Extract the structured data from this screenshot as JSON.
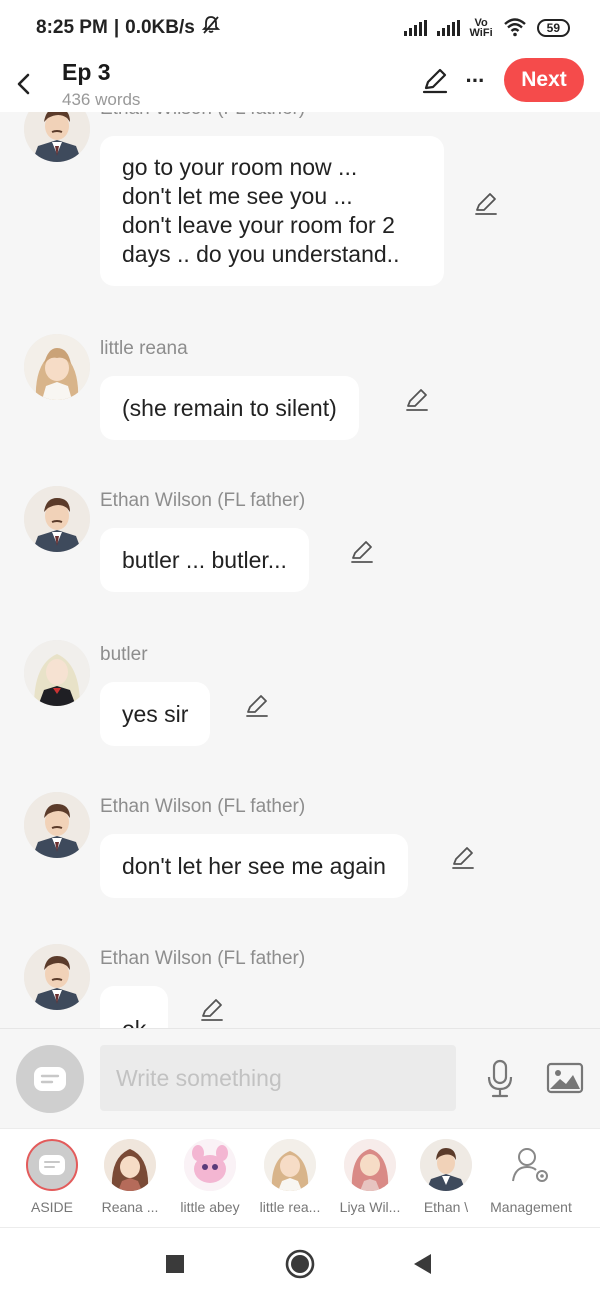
{
  "status": {
    "time": "8:25 PM",
    "net_speed": "0.0KB/s",
    "volte": "Vo\nWiFi",
    "battery": "59"
  },
  "header": {
    "title": "Ep 3",
    "word_count": "436 words",
    "next_label": "Next"
  },
  "messages": [
    {
      "speaker": "Ethan Wilson (FL father)",
      "lines": [
        "go to your room now ...",
        "don't let me see you ...",
        "don't leave your room for 2",
        "days .. do you understand.."
      ],
      "avatar": "ethan-avatar"
    },
    {
      "speaker": "little reana",
      "text": "(she remain to silent)",
      "avatar": "reana-avatar"
    },
    {
      "speaker": "Ethan Wilson (FL father)",
      "text": "butler ... butler...",
      "avatar": "ethan-avatar"
    },
    {
      "speaker": "butler",
      "text": "yes sir",
      "avatar": "butler-avatar"
    },
    {
      "speaker": "Ethan Wilson (FL father)",
      "text": "don't let her see me again",
      "avatar": "ethan-avatar"
    },
    {
      "speaker": "Ethan Wilson (FL father)",
      "text": "ok",
      "avatar": "ethan-avatar"
    }
  ],
  "composer": {
    "placeholder": "Write something"
  },
  "characters": [
    {
      "label": "ASIDE"
    },
    {
      "label": "Reana ..."
    },
    {
      "label": "little abey"
    },
    {
      "label": "little rea..."
    },
    {
      "label": "Liya Wil..."
    },
    {
      "label": "Ethan \\"
    },
    {
      "label": "Management"
    }
  ],
  "colors": {
    "accent": "#f54b4b",
    "background": "#f6f6f6",
    "bubble": "#ffffff",
    "speaker_text": "#8d8d8d"
  }
}
